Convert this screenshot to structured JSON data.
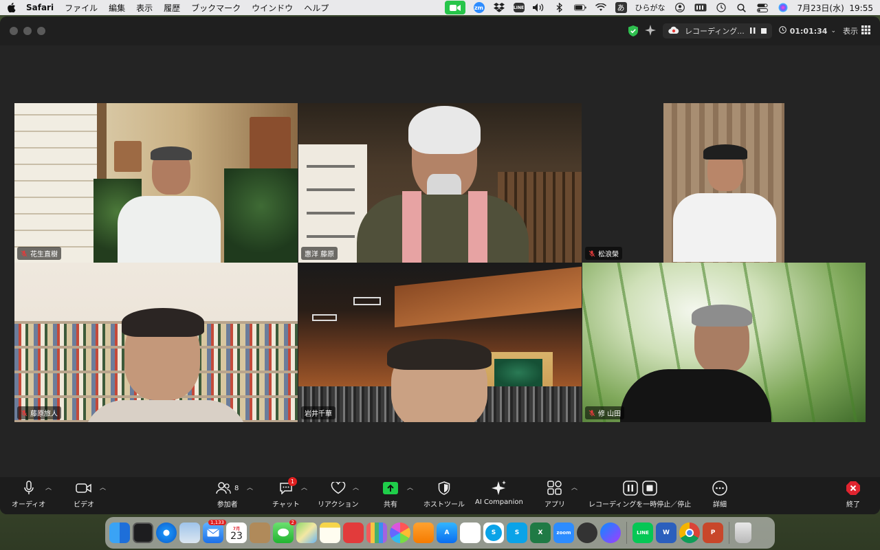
{
  "menubar": {
    "app": "Safari",
    "menus": [
      "ファイル",
      "編集",
      "表示",
      "履歴",
      "ブックマーク",
      "ウインドウ",
      "ヘルプ"
    ],
    "ime_symbol": "あ",
    "ime_label": "ひらがな",
    "clock": "7月23日(水)  19:55"
  },
  "zoom": {
    "recording_label": "レコーディング...",
    "timer": "01:01:34",
    "view_label": "表示",
    "participants": [
      {
        "name": "花生直樹",
        "muted": true
      },
      {
        "name": "惠洋 藤原",
        "muted": false
      },
      {
        "name": "松浪榮",
        "muted": true
      },
      {
        "name": "藤原旅人",
        "muted": true
      },
      {
        "name": "岩井千華",
        "muted": false
      },
      {
        "name": "修 山田",
        "muted": true
      }
    ],
    "toolbar": {
      "audio": "オーディオ",
      "video": "ビデオ",
      "participants": "参加者",
      "participants_count": "8",
      "chat": "チャット",
      "chat_badge": "1",
      "reactions": "リアクション",
      "share": "共有",
      "host_tools": "ホストツール",
      "ai_companion": "AI Companion",
      "apps": "アプリ",
      "recording": "レコーディングを一時停止／停止",
      "more": "詳細",
      "end": "終了"
    }
  },
  "dock": {
    "mail_badge": "1,133",
    "calendar_month": "7月",
    "calendar_day": "23",
    "messages_badge": "2",
    "zoom_label": "zoom",
    "line_label": "LINE",
    "word_label": "W",
    "excel_label": "X",
    "ppt_label": "P",
    "skype_label": "S"
  }
}
